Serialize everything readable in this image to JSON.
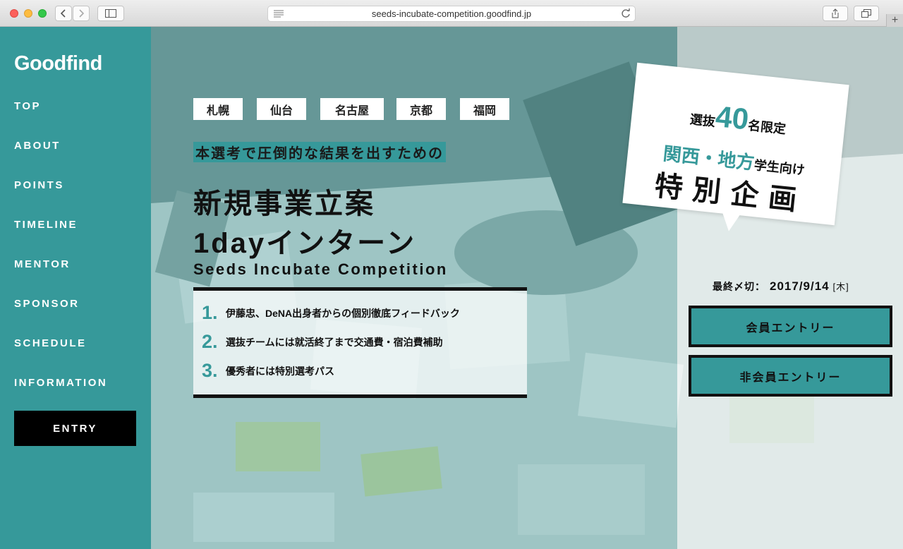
{
  "browser": {
    "url": "seeds-incubate-competition.goodfind.jp"
  },
  "sidebar": {
    "logo": "Goodfind",
    "items": [
      {
        "label": "TOP"
      },
      {
        "label": "ABOUT"
      },
      {
        "label": "POINTS"
      },
      {
        "label": "TIMELINE"
      },
      {
        "label": "MENTOR"
      },
      {
        "label": "SPONSOR"
      },
      {
        "label": "SCHEDULE"
      },
      {
        "label": "INFORMATION"
      }
    ],
    "entry_label": "ENTRY"
  },
  "hero": {
    "cities": [
      "札幌",
      "仙台",
      "名古屋",
      "京都",
      "福岡"
    ],
    "subcopy": "本選考で圧倒的な結果を出すための",
    "title_line1": "新規事業立案",
    "title_line2": "1dayインターン",
    "en_title": "Seeds Incubate Competition",
    "points": [
      {
        "num": "1.",
        "text": "伊藤忠、DeNA出身者からの個別徹底フィードバック"
      },
      {
        "num": "2.",
        "text": "選抜チームには就活終了まで交通費・宿泊費補助"
      },
      {
        "num": "3.",
        "text": "優秀者には特別選考パス"
      }
    ]
  },
  "card": {
    "line1_pre": "選抜",
    "line1_num": "40",
    "line1_post": "名限定",
    "line2_teal": "関西・地方",
    "line2_dark": "学生向け",
    "line3": "特別企画"
  },
  "deadline": {
    "label": "最終〆切：",
    "date": "2017/9/14",
    "dow": "[木]"
  },
  "buttons": {
    "member_entry": "会員エントリー",
    "nonmember_entry": "非会員エントリー"
  },
  "colors": {
    "accent": "#36999a",
    "button_border": "#111111"
  }
}
